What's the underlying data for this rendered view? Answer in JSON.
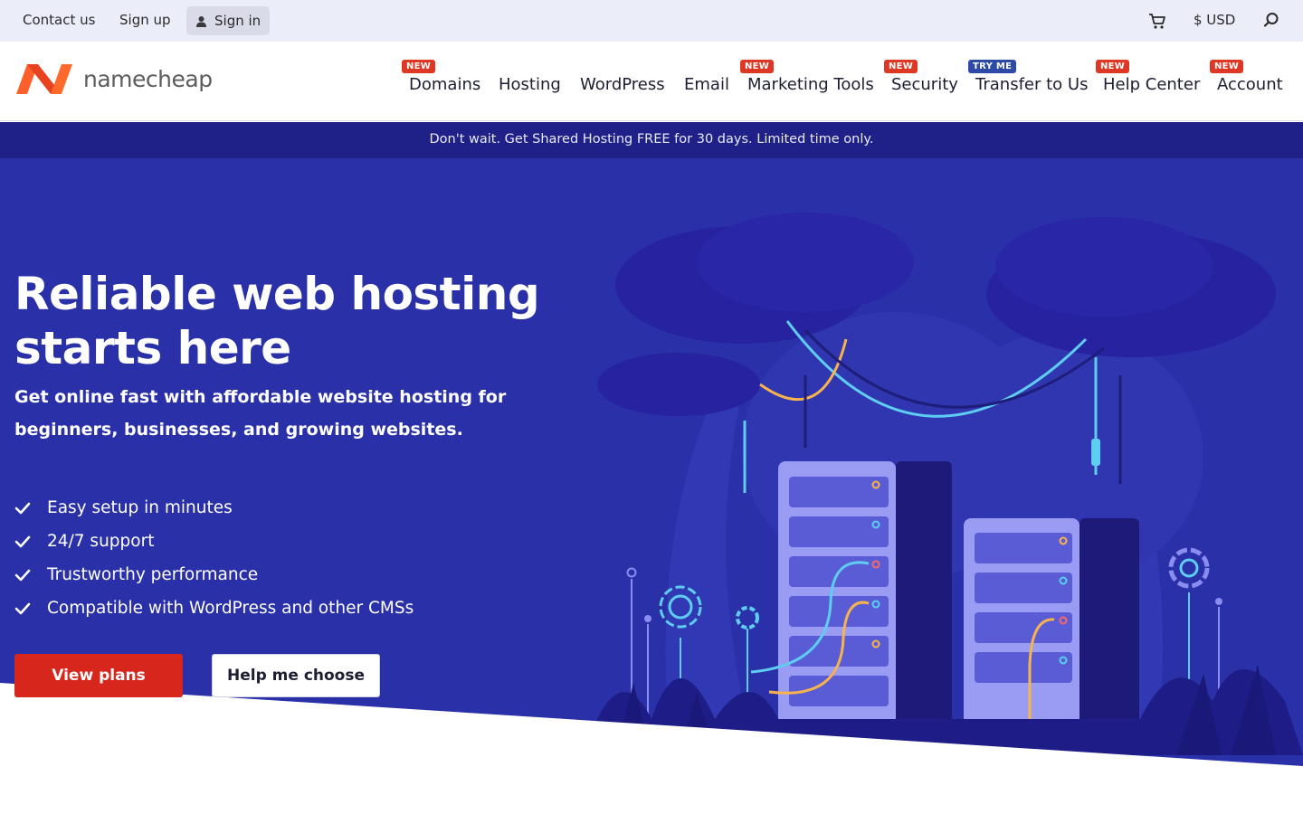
{
  "topbar": {
    "contact": "Contact us",
    "signup": "Sign up",
    "signin": "Sign in",
    "currency": "$ USD"
  },
  "brand": {
    "name": "namecheap",
    "accent": "#ff5f2a"
  },
  "nav": {
    "items": [
      {
        "label": "Domains",
        "badge": "NEW"
      },
      {
        "label": "Hosting",
        "badge": ""
      },
      {
        "label": "WordPress",
        "badge": ""
      },
      {
        "label": "Email",
        "badge": ""
      },
      {
        "label": "Marketing Tools",
        "badge": "NEW"
      },
      {
        "label": "Security",
        "badge": "NEW"
      },
      {
        "label": "Transfer to Us",
        "badge": "TRY ME"
      },
      {
        "label": "Help Center",
        "badge": "NEW"
      },
      {
        "label": "Account",
        "badge": "NEW"
      }
    ]
  },
  "promo": {
    "text": "Don't wait. Get Shared Hosting FREE for 30 days. Limited time only."
  },
  "hero": {
    "title_line1": "Reliable web hosting",
    "title_line2": "starts here",
    "subtitle": "Get online fast with affordable website hosting for beginners, businesses, and growing websites.",
    "features": [
      "Easy setup in minutes",
      "24/7 support",
      "Trustworthy performance",
      "Compatible with WordPress and other CMSs"
    ],
    "primary_button": "View plans",
    "secondary_button": "Help me choose"
  },
  "colors": {
    "hero_bg": "#2a30a8",
    "promo_bg": "#1f2189",
    "primary_button": "#d7261c",
    "topbar_bg": "#ebedf9"
  },
  "icons": [
    "user-icon",
    "cart-icon",
    "search-icon",
    "checkmark-icon",
    "namecheap-logo"
  ]
}
